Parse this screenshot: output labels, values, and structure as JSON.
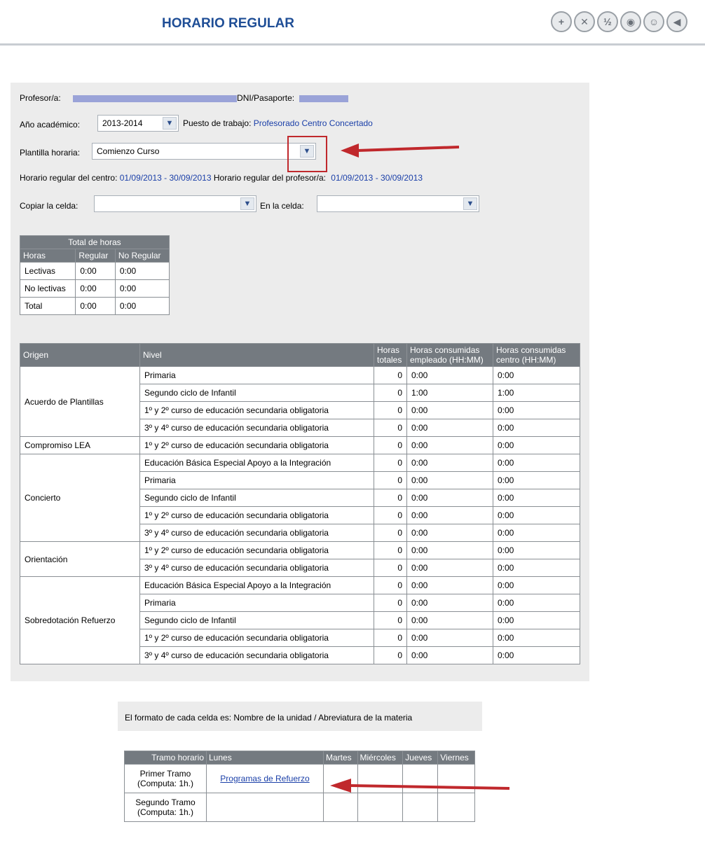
{
  "header": {
    "title": "HORARIO REGULAR",
    "icons": [
      "document-add-icon",
      "calendar-delete-icon",
      "calendar-half-icon",
      "clock-icon",
      "users-icon",
      "back-arrow-icon"
    ]
  },
  "form": {
    "profesor_label": "Profesor/a:",
    "dni_label": "DNI/Pasaporte:",
    "anio_label": "Año académico:",
    "anio_value": "2013-2014",
    "puesto_label": "Puesto de trabajo:",
    "puesto_value": "Profesorado Centro Concertado",
    "plantilla_label": "Plantilla horaria:",
    "plantilla_value": "Comienzo Curso",
    "centro_label": "Horario regular del centro:",
    "centro_value": "01/09/2013 - 30/09/2013",
    "prof_label": "Horario regular del profesor/a:",
    "prof_value": "01/09/2013 - 30/09/2013",
    "copiar_label": "Copiar la celda:",
    "en_label": "En la celda:"
  },
  "total": {
    "title": "Total de horas",
    "headers": [
      "Horas",
      "Regular",
      "No Regular"
    ],
    "rows": [
      [
        "Lectivas",
        "0:00",
        "0:00"
      ],
      [
        "No lectivas",
        "0:00",
        "0:00"
      ],
      [
        "Total",
        "0:00",
        "0:00"
      ]
    ]
  },
  "origen": {
    "headers": [
      "Origen",
      "Nivel",
      "Horas totales",
      "Horas consumidas empleado (HH:MM)",
      "Horas consumidas centro (HH:MM)"
    ],
    "groups": [
      {
        "origen": "Acuerdo de Plantillas",
        "rows": [
          [
            "Primaria",
            "0",
            "0:00",
            "0:00"
          ],
          [
            "Segundo ciclo de Infantil",
            "0",
            "1:00",
            "1:00"
          ],
          [
            "1º y 2º curso de educación secundaria obligatoria",
            "0",
            "0:00",
            "0:00"
          ],
          [
            "3º y 4º curso de educación secundaria obligatoria",
            "0",
            "0:00",
            "0:00"
          ]
        ]
      },
      {
        "origen": "Compromiso LEA",
        "rows": [
          [
            "1º y 2º curso de educación secundaria obligatoria",
            "0",
            "0:00",
            "0:00"
          ]
        ]
      },
      {
        "origen": "Concierto",
        "rows": [
          [
            "Educación Básica Especial Apoyo a la Integración",
            "0",
            "0:00",
            "0:00"
          ],
          [
            "Primaria",
            "0",
            "0:00",
            "0:00"
          ],
          [
            "Segundo ciclo de Infantil",
            "0",
            "0:00",
            "0:00"
          ],
          [
            "1º y 2º curso de educación secundaria obligatoria",
            "0",
            "0:00",
            "0:00"
          ],
          [
            "3º y 4º curso de educación secundaria obligatoria",
            "0",
            "0:00",
            "0:00"
          ]
        ]
      },
      {
        "origen": "Orientación",
        "rows": [
          [
            "1º y 2º curso de educación secundaria obligatoria",
            "0",
            "0:00",
            "0:00"
          ],
          [
            "3º y 4º curso de educación secundaria obligatoria",
            "0",
            "0:00",
            "0:00"
          ]
        ]
      },
      {
        "origen": "Sobredotación Refuerzo",
        "rows": [
          [
            "Educación Básica Especial Apoyo a la Integración",
            "0",
            "0:00",
            "0:00"
          ],
          [
            "Primaria",
            "0",
            "0:00",
            "0:00"
          ],
          [
            "Segundo ciclo de Infantil",
            "0",
            "0:00",
            "0:00"
          ],
          [
            "1º y 2º curso de educación secundaria obligatoria",
            "0",
            "0:00",
            "0:00"
          ],
          [
            "3º y 4º curso de educación secundaria obligatoria",
            "0",
            "0:00",
            "0:00"
          ]
        ]
      }
    ]
  },
  "format_note": "El formato de cada celda es: Nombre de la unidad / Abreviatura de la materia",
  "schedule": {
    "headers": [
      "Tramo horario",
      "Lunes",
      "Martes",
      "Miércoles",
      "Jueves",
      "Viernes"
    ],
    "rows": [
      {
        "tramo": "Primer Tramo",
        "computa": "(Computa: 1h.)",
        "lunes": "Programas de Refuerzo"
      },
      {
        "tramo": "Segundo Tramo",
        "computa": "(Computa: 1h.)",
        "lunes": ""
      }
    ]
  },
  "colors": {
    "accent": "#1f4e96",
    "link": "#1a3fa8",
    "annotation": "#c0282c",
    "header_bg": "#747a80"
  }
}
